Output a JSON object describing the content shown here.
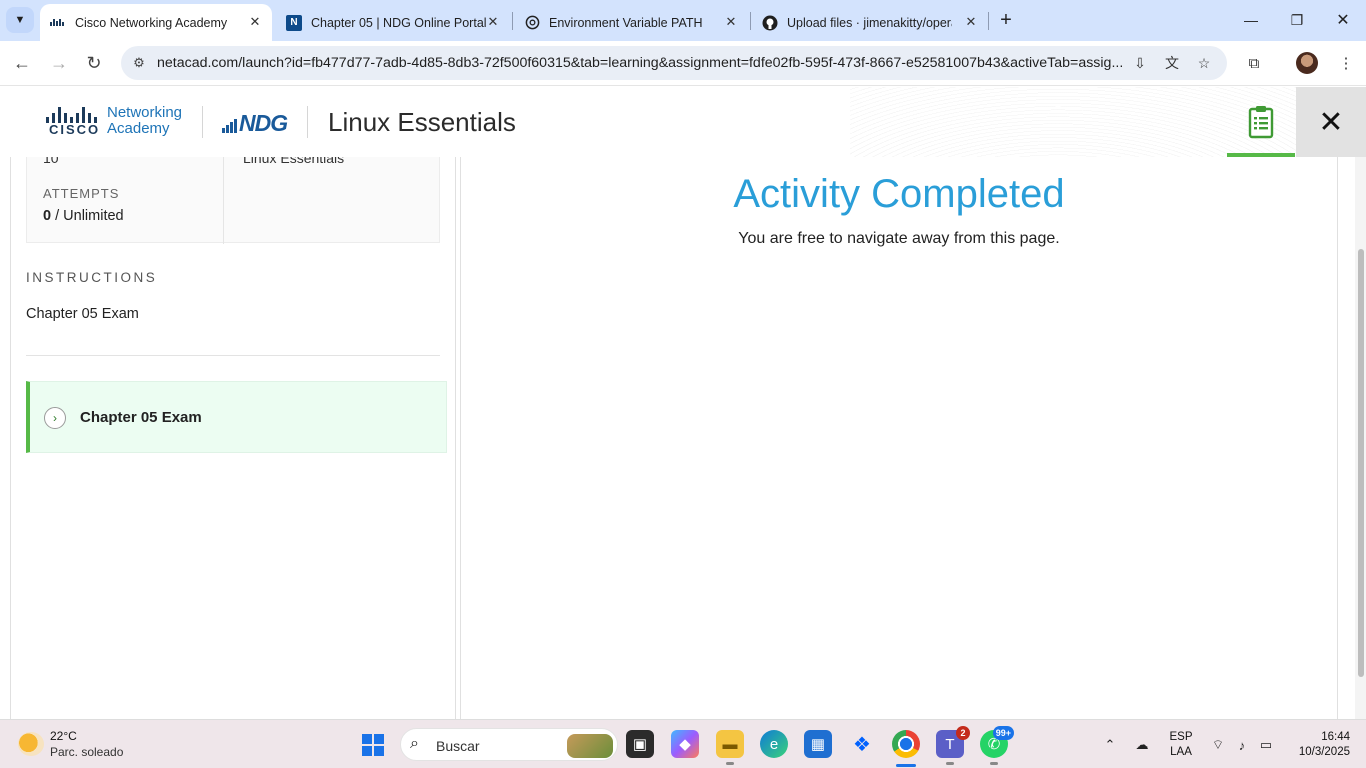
{
  "browser": {
    "tabs": [
      {
        "title": "Cisco Networking Academy",
        "favicon": "cisco-icon",
        "active": true
      },
      {
        "title": "Chapter 05 | NDG Online Portal",
        "favicon": "ndg-n-icon",
        "active": false
      },
      {
        "title": "Environment Variable PATH",
        "favicon": "openai-icon",
        "active": false
      },
      {
        "title": "Upload files · jimenakitty/opera",
        "favicon": "github-icon",
        "active": false
      }
    ],
    "url": "netacad.com/launch?id=fb477d77-7adb-4d85-8db3-72f500f60315&tab=learning&assignment=fdfe02fb-595f-473f-8667-e52581007b43&activeTab=assig..."
  },
  "header": {
    "logo_line1": "Networking",
    "logo_line2": "Academy",
    "cisco_word": "CISCO",
    "ndg_word": "NDG",
    "course_title": "Linux Essentials",
    "accent_color": "#56b947"
  },
  "sidebar": {
    "cut_left_value": "10",
    "cut_right_value": "Linux Essentials",
    "attempts_label": "ATTEMPTS",
    "attempts_used": "0",
    "attempts_separator": "/",
    "attempts_total": "Unlimited",
    "instructions_label": "INSTRUCTIONS",
    "instructions_text": "Chapter 05 Exam",
    "item_label": "Chapter 05 Exam"
  },
  "main": {
    "title": "Activity Completed",
    "subtitle": "You are free to navigate away from this page.",
    "title_color": "#2a9ed8"
  },
  "taskbar": {
    "temperature": "22°C",
    "condition": "Parc. soleado",
    "search_placeholder": "Buscar",
    "teams_badge": "2",
    "whatsapp_badge": "99+",
    "lang_line1": "ESP",
    "lang_line2": "LAA",
    "time": "16:44",
    "date": "10/3/2025"
  }
}
